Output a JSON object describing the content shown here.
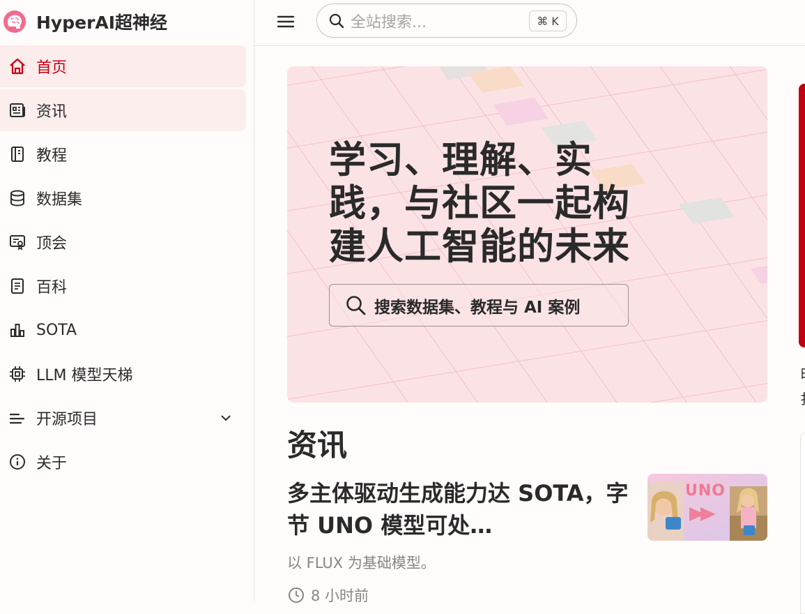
{
  "brand": {
    "name": "HyperAI超神经"
  },
  "nav": {
    "items": [
      {
        "label": "首页",
        "icon": "home-icon",
        "state": "active"
      },
      {
        "label": "资讯",
        "icon": "newspaper-icon",
        "state": "hover"
      },
      {
        "label": "教程",
        "icon": "notebook-icon",
        "state": ""
      },
      {
        "label": "数据集",
        "icon": "database-icon",
        "state": ""
      },
      {
        "label": "顶会",
        "icon": "certificate-icon",
        "state": ""
      },
      {
        "label": "百科",
        "icon": "document-icon",
        "state": ""
      },
      {
        "label": "SOTA",
        "icon": "bar-chart-icon",
        "state": ""
      },
      {
        "label": "LLM 模型天梯",
        "icon": "chip-icon",
        "state": ""
      },
      {
        "label": "开源项目",
        "icon": "list-icon",
        "state": "",
        "expandable": true
      },
      {
        "label": "关于",
        "icon": "info-icon",
        "state": ""
      }
    ]
  },
  "topbar": {
    "search_placeholder": "全站搜索...",
    "shortcut": "⌘ K"
  },
  "hero": {
    "title": "学习、理解、实践，与社区一起构建人工智能的未来",
    "search_label": "搜索数据集、教程与 AI 案例"
  },
  "news": {
    "section_title": "资讯",
    "article": {
      "title": "多主体驱动生成能力达 SOTA，字节 UNO 模型可处…",
      "desc": "以 FLUX 为基础模型。",
      "time": "8 小时前",
      "thumb_text": "UNO"
    }
  },
  "right": {
    "line1": "由",
    "line2": "扌"
  },
  "colors": {
    "accent": "#c70012",
    "hero_bg": "#fbe3e5",
    "active_bg": "#fdecec"
  }
}
